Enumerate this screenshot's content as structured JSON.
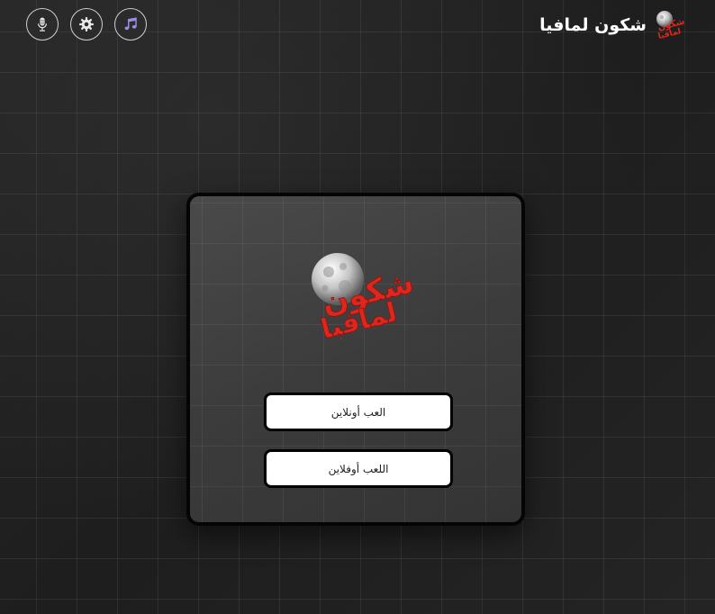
{
  "header": {
    "title": "شكون لمافيا",
    "logo": {
      "icon": "moon-logo-icon",
      "text_line1": "شكون",
      "text_line2": "لمافيا"
    },
    "controls": [
      {
        "name": "microphone-button",
        "icon": "microphone-icon"
      },
      {
        "name": "settings-button",
        "icon": "gear-icon"
      },
      {
        "name": "music-button",
        "icon": "music-note-icon"
      }
    ]
  },
  "card": {
    "logo": {
      "icon": "moon-logo-icon",
      "text_line1": "شكون",
      "text_line2": "لمافيا"
    },
    "buttons": {
      "play_online": "العب أونلاين",
      "play_offline": "اللعب أوفلاين"
    }
  },
  "colors": {
    "logo_red": "#e0261c",
    "accent_purple": "#7b68c8",
    "background": "#232323"
  }
}
